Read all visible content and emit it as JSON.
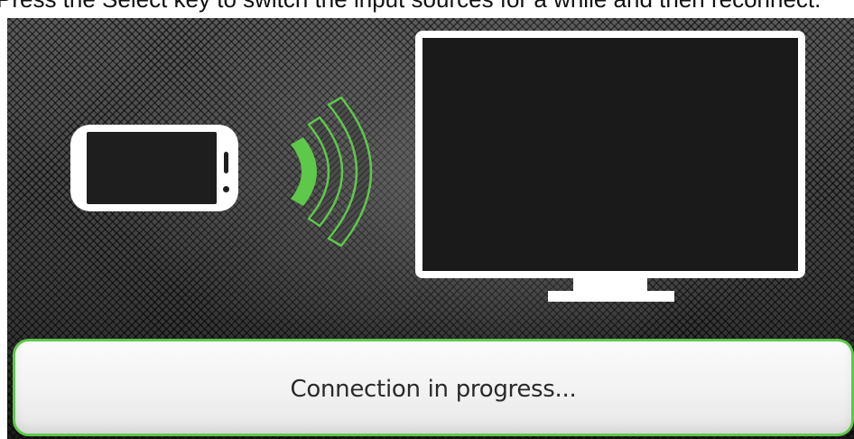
{
  "caption": {
    "text": "Press the Select key to switch the input sources for a while and then reconnect."
  },
  "illustration": {
    "source_device": "smartphone-icon",
    "signal": "wireless-signal-icon",
    "target_device": "tv-icon"
  },
  "status": {
    "message": "Connection in progress..."
  },
  "colors": {
    "accent": "#5ec84a",
    "background": "#3a3a3a",
    "device_outline": "#ffffff",
    "device_screen": "#1a1a1a",
    "status_text": "#2a2a2a"
  }
}
